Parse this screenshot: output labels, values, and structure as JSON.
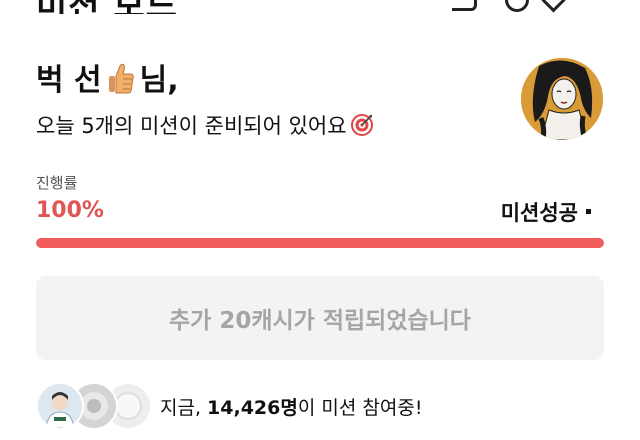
{
  "header": {
    "title_partial": "미션 보드"
  },
  "greeting": {
    "name": "벅 선",
    "suffix": "님,"
  },
  "subtitle": "오늘 5개의 미션이 준비되어 있어요",
  "progress": {
    "label": "진행률",
    "value_text": "100%",
    "percent": 100,
    "status": "미션성공"
  },
  "reward": {
    "message": "추가 20캐시가 적립되었습니다"
  },
  "participants": {
    "prefix": "지금, ",
    "count": "14,426명",
    "suffix": "이 미션 참여중!"
  },
  "colors": {
    "accent": "#f15b5b",
    "progress_text": "#e05555",
    "reward_bg": "#f3f3f3",
    "reward_text": "#a5a5a5"
  }
}
